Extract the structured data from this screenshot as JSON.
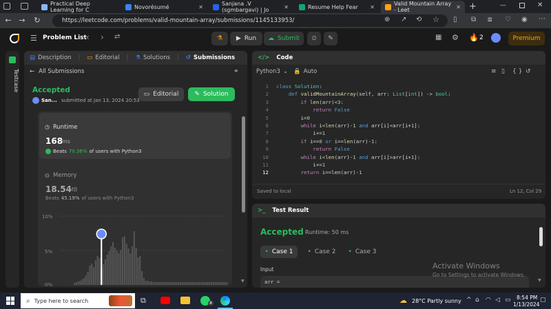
{
  "browser": {
    "tabs": [
      {
        "label": "Practical Deep Learning for C",
        "color": "#8ab4f8"
      },
      {
        "label": "Novorésumé",
        "color": "#3b82f6"
      },
      {
        "label": "Sanjana .V (sgmbargavi) | Jo",
        "color": "#2563eb"
      },
      {
        "label": "Resume Help Fear",
        "color": "#10a37f"
      },
      {
        "label": "Valid Mountain Array - Leet",
        "color": "#ffa116"
      }
    ],
    "url": "https://leetcode.com/problems/valid-mountain-array/submissions/1145133953/"
  },
  "lc_nav": {
    "problem_list": "Problem List",
    "run": "Run",
    "submit": "Submit",
    "streak": "2",
    "premium": "Premium"
  },
  "left": {
    "testcase_tab": "Testcase",
    "tabs": [
      "Description",
      "Editorial",
      "Solutions",
      "Submissions"
    ],
    "all_submissions": "All Submissions",
    "status": "Accepted",
    "user": "San...",
    "submitted": "submitted at Jan 13, 2024 20:53",
    "editorial_btn": "Editorial",
    "solution_btn": "Solution",
    "runtime_label": "Runtime",
    "runtime_value": "168",
    "runtime_unit": "ms",
    "runtime_beats_pre": "Beats",
    "runtime_beats_pct": "70.36%",
    "runtime_beats_post": "of users with Python3",
    "memory_label": "Memory",
    "memory_value": "18.54",
    "memory_unit": "MB",
    "memory_beats_pre": "Beats",
    "memory_beats_pct": "45.19%",
    "memory_beats_post": "of users with Python3",
    "chart_ticks": [
      "10%",
      "5%",
      "0%"
    ]
  },
  "chart_data": {
    "type": "bar",
    "yticks": [
      "10%",
      "5%",
      "0%"
    ],
    "ylim": [
      0,
      10
    ],
    "values": [
      0.3,
      0.4,
      0.5,
      0.6,
      0.8,
      1.0,
      1.4,
      1.9,
      2.8,
      3.1,
      2.6,
      3.6,
      4.2,
      3.9,
      2.4,
      3.0,
      3.7,
      4.4,
      4.9,
      5.6,
      6.2,
      5.4,
      5.0,
      4.6,
      5.1,
      6.9,
      7.1,
      6.0,
      5.3,
      4.6,
      5.6,
      7.8,
      5.4,
      4.0,
      4.2,
      2.0,
      1.0,
      0.6,
      0.6,
      0.5,
      0.5,
      0.4,
      0.4,
      0.4,
      0.4,
      0.4,
      0.4,
      0.4,
      0.4,
      0.4,
      0.4,
      0.4,
      0.4,
      0.4,
      0.4,
      0.4,
      0.4,
      0.4,
      0.4,
      0.4,
      0.4,
      0.4,
      0.4,
      0.4,
      0.4,
      0.4,
      0.4,
      0.4,
      0.4,
      0.4,
      0.4,
      0.4,
      0.4,
      0.4,
      0.4,
      0.4,
      0.4,
      0.4,
      0.4,
      0.4
    ],
    "highlight_index": 14
  },
  "code_panel": {
    "title": "Code",
    "language": "Python3",
    "mode": "Auto",
    "saved": "Saved to local",
    "cursor": "Ln 12, Col 29"
  },
  "test_panel": {
    "title": "Test Result",
    "status": "Accepted",
    "runtime": "Runtime: 50 ms",
    "cases": [
      "Case 1",
      "Case 2",
      "Case 3"
    ],
    "input_label": "Input",
    "input_value": "arr ="
  },
  "watermark": {
    "line1": "Activate Windows",
    "line2": "Go to Settings to activate Windows."
  },
  "taskbar": {
    "search_placeholder": "Type here to search",
    "weather": "28°C  Partly sunny",
    "time": "8:54 PM",
    "date": "1/13/2024",
    "badge": "4"
  }
}
